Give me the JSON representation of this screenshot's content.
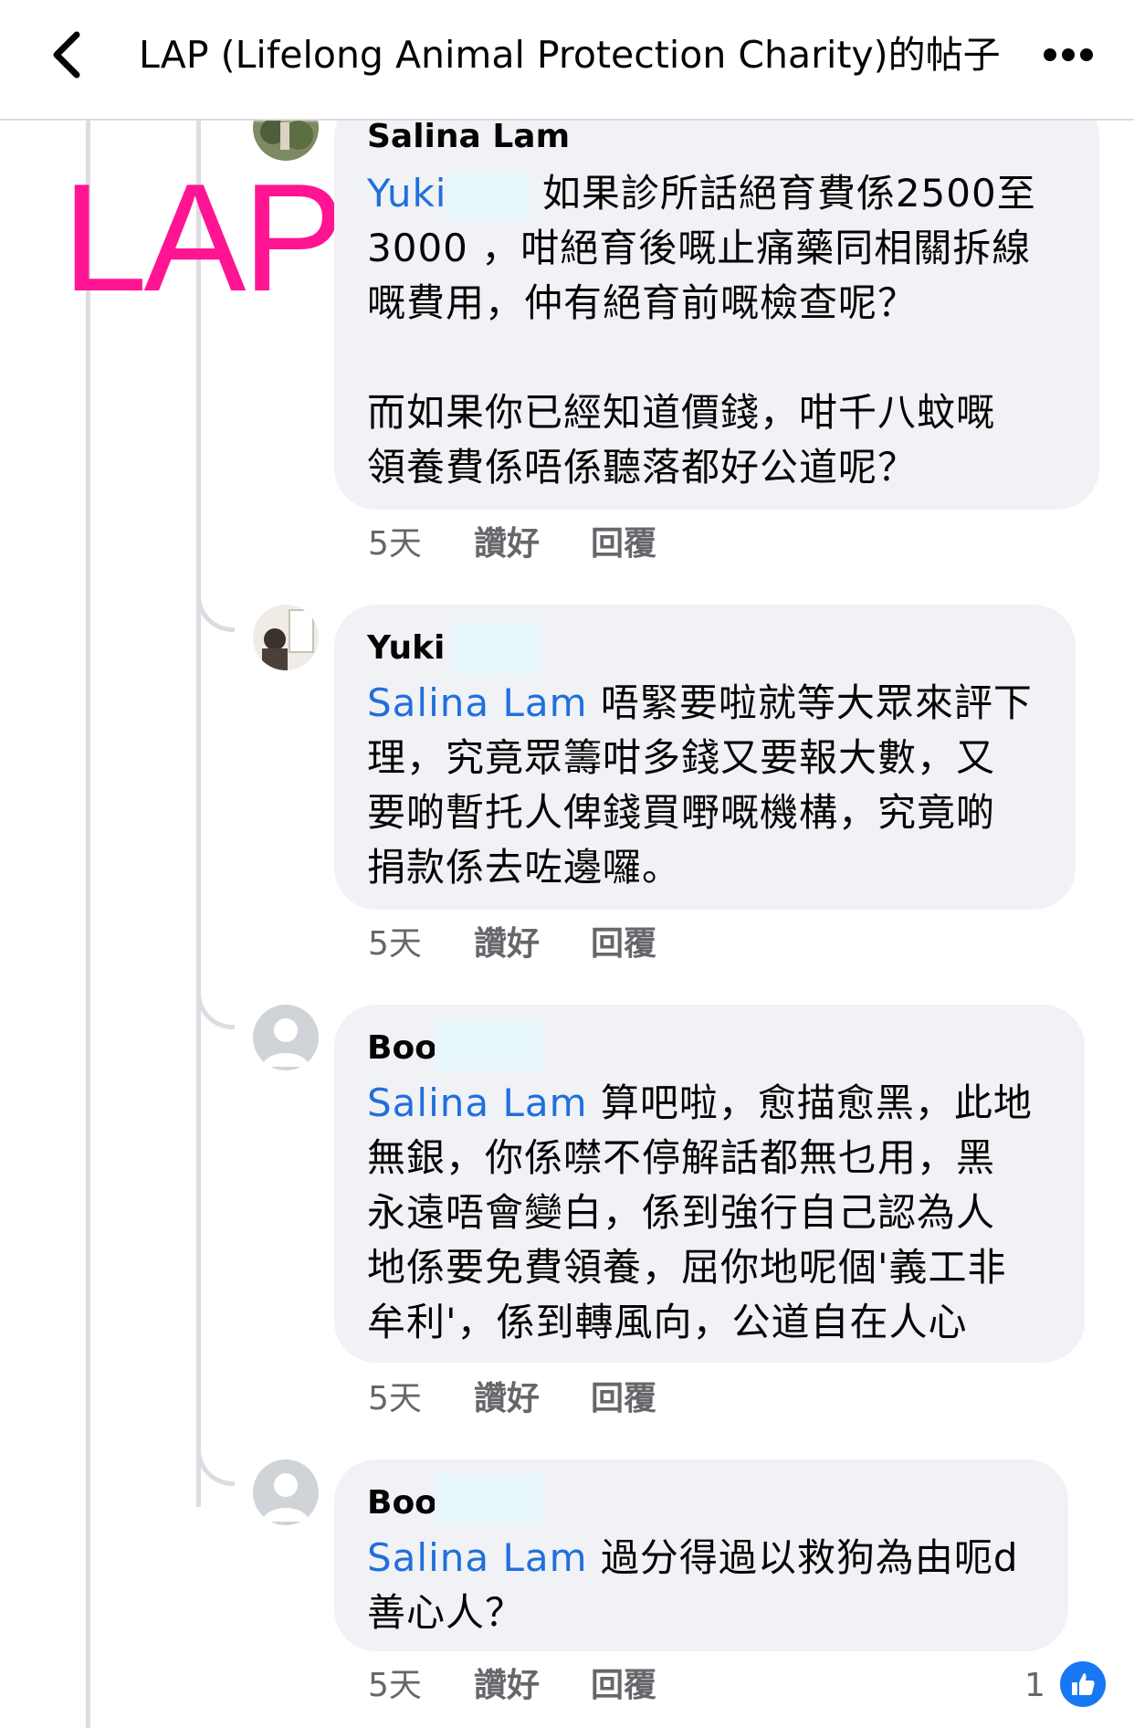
{
  "header": {
    "title": "LAP (Lifelong Animal Protection Charity)的帖子"
  },
  "watermark": "LAP",
  "comments": [
    {
      "author": "Salina Lam",
      "mention": "Yuki",
      "text_line1_after_mention": "如果診所話絕育費係2500至",
      "text_rest": "3000 ，咁絕育後嘅止痛藥同相關拆線\n嘅費用，仲有絕育前嘅檢查呢？\n\n而如果你已經知道價錢，咁千八蚊嘅\n領養費係唔係聽落都好公道呢？",
      "time": "5天",
      "like_label": "讚好",
      "reply_label": "回覆"
    },
    {
      "author": "Yuki",
      "mention": "Salina Lam",
      "text_line1_after_mention": "唔緊要啦就等大眾來評下",
      "text_rest": "理，究竟眾籌咁多錢又要報大數，又\n要啲暫托人俾錢買嘢嘅機構，究竟啲\n捐款係去咗邊囉。",
      "time": "5天",
      "like_label": "讚好",
      "reply_label": "回覆"
    },
    {
      "author": "Boo",
      "mention": "Salina Lam",
      "text_line1_after_mention": "算吧啦，愈描愈黑，此地",
      "text_rest": "無銀，你係噤不停解話都無乜用，黑\n永遠唔會變白，係到強行自己認為人\n地係要免費領養，屈你地呢個'義工非\n牟利'，係到轉風向，公道自在人心",
      "time": "5天",
      "like_label": "讚好",
      "reply_label": "回覆"
    },
    {
      "author": "Boo",
      "mention": "Salina Lam",
      "text_line1_after_mention": "過分得過以救狗為由呃d",
      "text_rest": "善心人？",
      "time": "5天",
      "like_label": "讚好",
      "reply_label": "回覆",
      "reaction_count": "1"
    }
  ],
  "colors": {
    "mention": "#216fdb",
    "watermark": "#ff1493",
    "bubble": "#f0f2f5",
    "meta": "#65676b",
    "like": "#1877f2"
  },
  "icons": {
    "back": "chevron-left-icon",
    "more": "more-dots-icon",
    "like": "thumbs-up-icon"
  }
}
